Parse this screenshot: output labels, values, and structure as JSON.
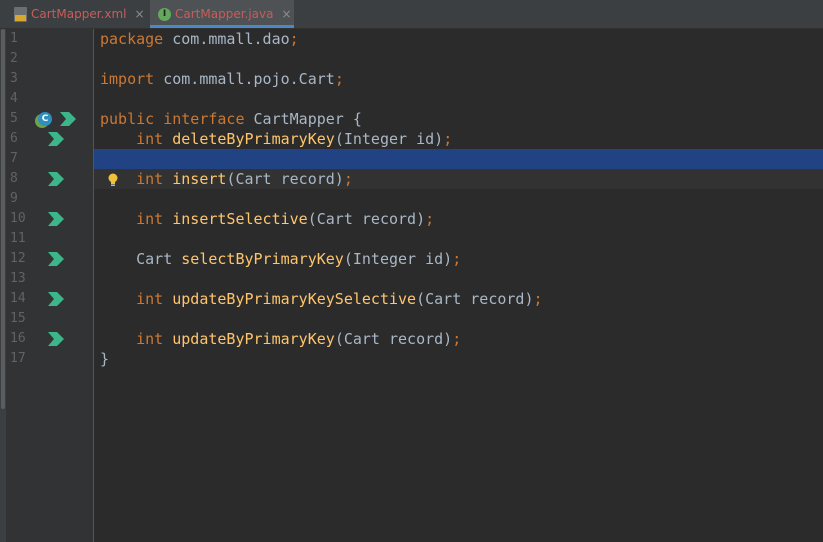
{
  "tabs": [
    {
      "label": "CartMapper.xml",
      "icon": "xml-file-icon",
      "close": "×",
      "active": false
    },
    {
      "label": "CartMapper.java",
      "icon": "interface-icon",
      "icon_letter": "I",
      "close": "×",
      "active": true
    }
  ],
  "gutter": {
    "line_numbers": [
      "1",
      "2",
      "3",
      "4",
      "5",
      "6",
      "7",
      "8",
      "9",
      "10",
      "11",
      "12",
      "13",
      "14",
      "15",
      "16",
      "17"
    ],
    "implemented_marker": "C",
    "colors": {
      "navigate_arrow": "#3db58a",
      "implemented_marker": "#2f8fbf"
    }
  },
  "editor": {
    "selected_line": 8,
    "colors": {
      "background": "#2b2b2b",
      "keyword": "#cc7832",
      "method": "#ffc66d",
      "text": "#a9b7c6",
      "selection": "#214283"
    },
    "lines": [
      [
        {
          "t": "kw",
          "v": "package "
        },
        {
          "t": "pl",
          "v": "com.mmall.dao"
        },
        {
          "t": "pn",
          "v": ";"
        }
      ],
      [],
      [
        {
          "t": "kw",
          "v": "import "
        },
        {
          "t": "pl",
          "v": "com.mmall.pojo.Cart"
        },
        {
          "t": "pn",
          "v": ";"
        }
      ],
      [],
      [
        {
          "t": "kw",
          "v": "public interface "
        },
        {
          "t": "pl",
          "v": "CartMapper {"
        }
      ],
      [
        {
          "t": "pl",
          "v": "    "
        },
        {
          "t": "kw",
          "v": "int "
        },
        {
          "t": "fn",
          "v": "deleteByPrimaryKey"
        },
        {
          "t": "pl",
          "v": "(Integer id)"
        },
        {
          "t": "pn",
          "v": ";"
        }
      ],
      [],
      [
        {
          "t": "pl",
          "v": "    "
        },
        {
          "t": "kw",
          "v": "int "
        },
        {
          "t": "fn",
          "v": "insert"
        },
        {
          "t": "pl",
          "v": "(Cart record)"
        },
        {
          "t": "pn",
          "v": ";"
        }
      ],
      [],
      [
        {
          "t": "pl",
          "v": "    "
        },
        {
          "t": "kw",
          "v": "int "
        },
        {
          "t": "fn",
          "v": "insertSelective"
        },
        {
          "t": "pl",
          "v": "(Cart record)"
        },
        {
          "t": "pn",
          "v": ";"
        }
      ],
      [],
      [
        {
          "t": "pl",
          "v": "    Cart "
        },
        {
          "t": "fn",
          "v": "selectByPrimaryKey"
        },
        {
          "t": "pl",
          "v": "(Integer id)"
        },
        {
          "t": "pn",
          "v": ";"
        }
      ],
      [],
      [
        {
          "t": "pl",
          "v": "    "
        },
        {
          "t": "kw",
          "v": "int "
        },
        {
          "t": "fn",
          "v": "updateByPrimaryKeySelective"
        },
        {
          "t": "pl",
          "v": "(Cart record)"
        },
        {
          "t": "pn",
          "v": ";"
        }
      ],
      [],
      [
        {
          "t": "pl",
          "v": "    "
        },
        {
          "t": "kw",
          "v": "int "
        },
        {
          "t": "fn",
          "v": "updateByPrimaryKey"
        },
        {
          "t": "pl",
          "v": "(Cart record)"
        },
        {
          "t": "pn",
          "v": ";"
        }
      ],
      [
        {
          "t": "pl",
          "v": "}"
        }
      ]
    ]
  }
}
